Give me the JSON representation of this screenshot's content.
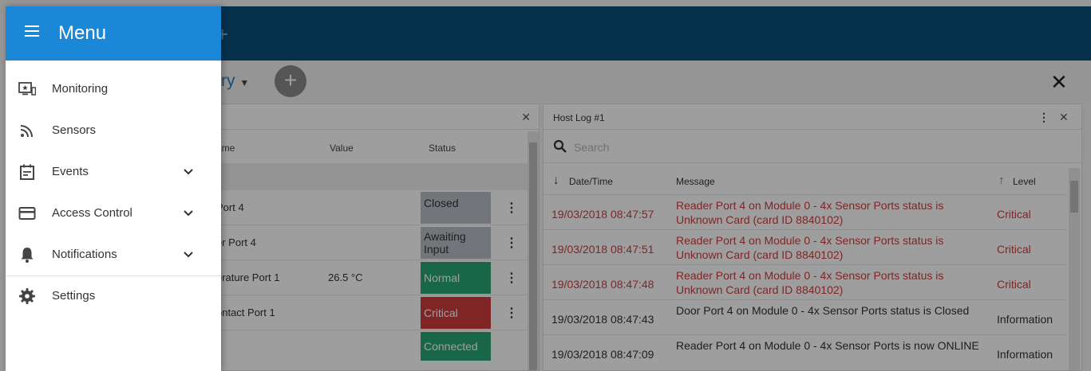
{
  "menu": {
    "title": "Menu",
    "items": [
      {
        "label": "Monitoring",
        "icon": "monitor-star-icon"
      },
      {
        "label": "Sensors",
        "icon": "rss-icon"
      },
      {
        "label": "Events",
        "icon": "calendar-icon"
      },
      {
        "label": "Access Control",
        "icon": "card-icon"
      },
      {
        "label": "Notifications",
        "icon": "bell-icon"
      },
      {
        "label": "Settings",
        "icon": "gear-icon"
      }
    ]
  },
  "dashboard": {
    "title_visible": "ry",
    "add_label": "+",
    "topbar_plus": "+"
  },
  "sensors_panel": {
    "columns": {
      "name": "ame",
      "value": "Value",
      "status": "Status"
    },
    "rows": [
      {
        "name": "Port 4",
        "value": "",
        "status": "Closed"
      },
      {
        "name": "er Port 4",
        "value": "",
        "status": "Awaiting Input"
      },
      {
        "name": "erature Port 1",
        "value": "26.5 °C",
        "status": "Normal"
      },
      {
        "name": "ontact Port 1",
        "value": "",
        "status": "Critical"
      },
      {
        "name": "",
        "value": "",
        "status": "Connected"
      }
    ]
  },
  "host_log": {
    "title": "Host Log #1",
    "search_placeholder": "Search",
    "columns": {
      "datetime": "Date/Time",
      "message": "Message",
      "level": "Level"
    },
    "rows": [
      {
        "datetime": "19/03/2018 08:47:57",
        "message": "Reader Port 4 on Module 0 - 4x Sensor Ports status is Unknown Card (card ID 8840102)",
        "level": "Critical"
      },
      {
        "datetime": "19/03/2018 08:47:51",
        "message": "Reader Port 4 on Module 0 - 4x Sensor Ports status is Unknown Card (card ID 8840102)",
        "level": "Critical"
      },
      {
        "datetime": "19/03/2018 08:47:48",
        "message": "Reader Port 4 on Module 0 - 4x Sensor Ports status is Unknown Card (card ID 8840102)",
        "level": "Critical"
      },
      {
        "datetime": "19/03/2018 08:47:43",
        "message": "Door Port 4 on Module 0 - 4x Sensor Ports status is Closed",
        "level": "Information"
      },
      {
        "datetime": "19/03/2018 08:47:09",
        "message": "Reader Port 4 on Module 0 - 4x Sensor Ports is now ONLINE",
        "level": "Information"
      }
    ]
  },
  "colors": {
    "topbar": "#0a4f7c",
    "drawer_header": "#1a88d6",
    "critical": "#cf3d3d",
    "normal": "#2aa575"
  }
}
